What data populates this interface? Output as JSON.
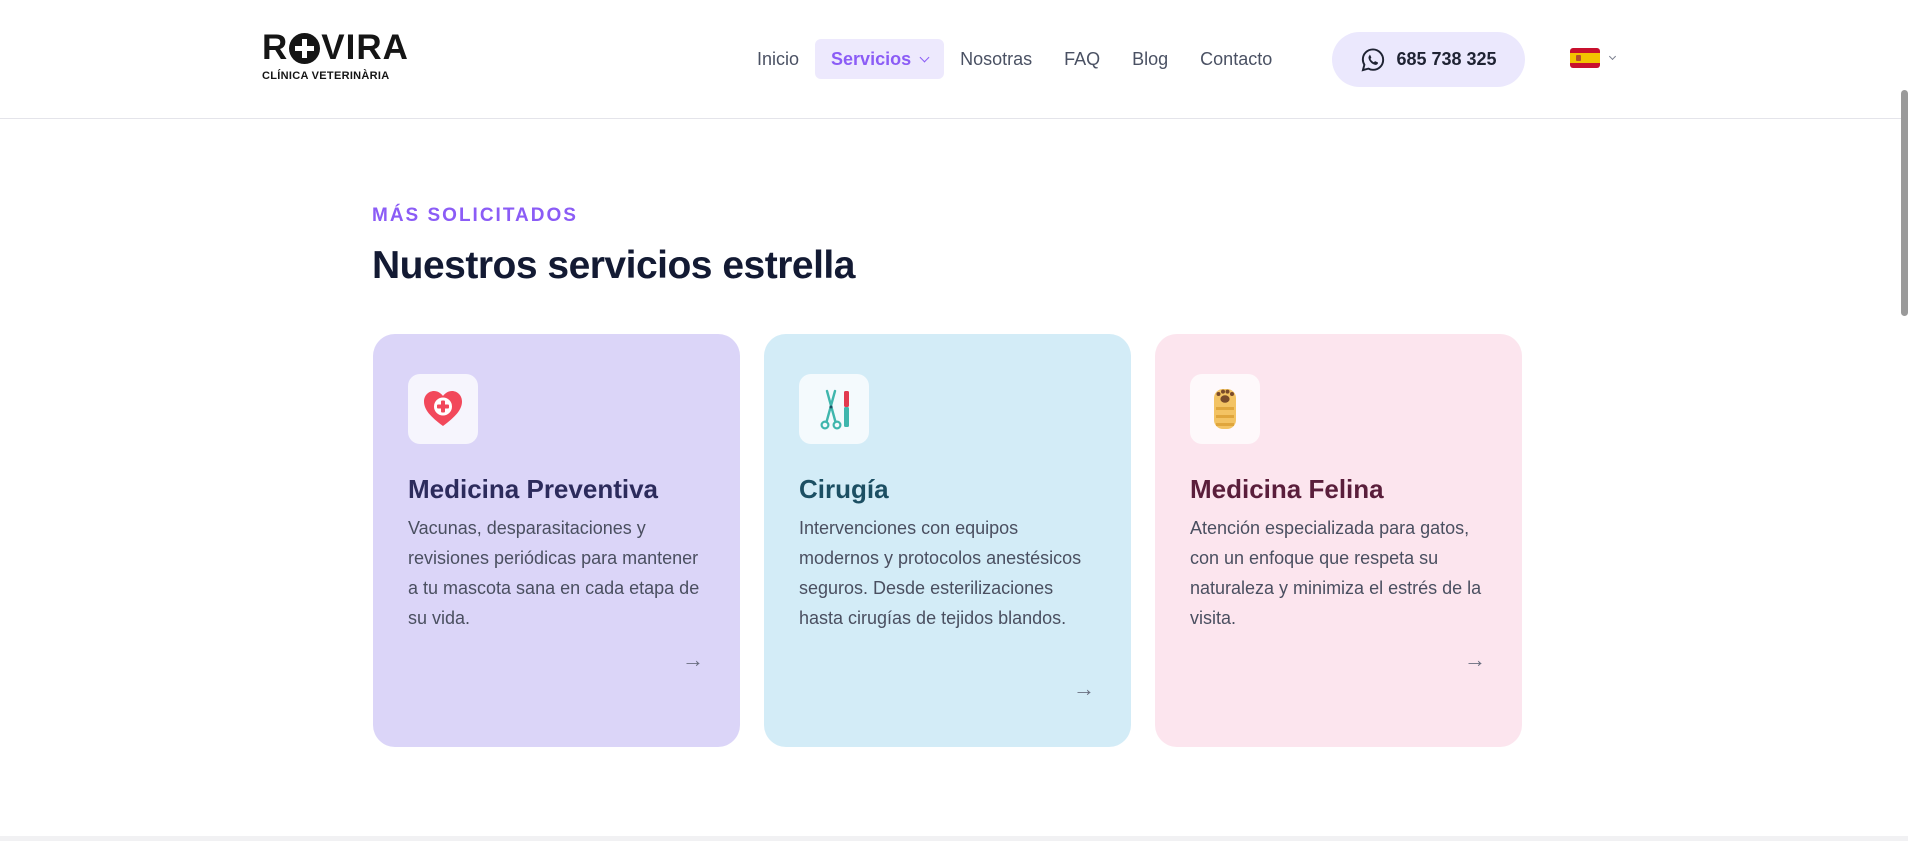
{
  "header": {
    "logo": {
      "brand": "ROVIRA",
      "subtitle": "CLÍNICA VETERINÀRIA"
    },
    "nav": [
      {
        "label": "Inicio"
      },
      {
        "label": "Servicios",
        "active": true
      },
      {
        "label": "Nosotras"
      },
      {
        "label": "FAQ"
      },
      {
        "label": "Blog"
      },
      {
        "label": "Contacto"
      }
    ],
    "phone": {
      "number": "685 738 325",
      "icon": "whatsapp-icon"
    },
    "language": {
      "flag": "spain-flag-icon"
    }
  },
  "section": {
    "eyebrow": "MÁS SOLICITADOS",
    "title": "Nuestros servicios estrella",
    "cards": [
      {
        "title": "Medicina Preventiva",
        "description": "Vacunas, desparasitaciones y revisiones periódicas para mantener a tu mascota sana en cada etapa de su vida.",
        "icon": "heart-medical-icon",
        "arrow": "→",
        "color": "#dbd5f8"
      },
      {
        "title": "Cirugía",
        "description": "Intervenciones con equipos modernos y protocolos anestésicos seguros. Desde esterilizaciones hasta cirugías de tejidos blandos.",
        "icon": "surgery-tools-icon",
        "arrow": "→",
        "color": "#d3ecf7"
      },
      {
        "title": "Medicina Felina",
        "description": "Atención especializada para gatos, con un enfoque que respeta su naturaleza y minimiza el estrés de la visita.",
        "icon": "cat-paw-icon",
        "arrow": "→",
        "color": "#fce5ee"
      }
    ]
  },
  "colors": {
    "accent": "#8b5cf6",
    "accent_bg": "#ede9fd"
  }
}
